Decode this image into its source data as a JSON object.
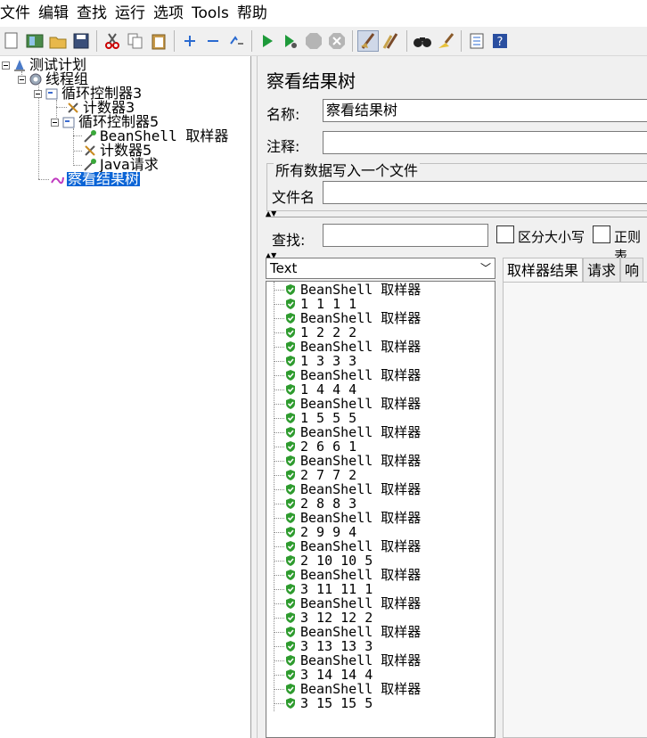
{
  "menu": [
    "文件",
    "编辑",
    "查找",
    "运行",
    "选项",
    "Tools",
    "帮助"
  ],
  "toolbar": {
    "icons": [
      "new-icon",
      "templates-icon",
      "open-icon",
      "save-icon",
      "cut-icon",
      "copy-icon",
      "paste-icon",
      "expand-icon",
      "collapse-icon",
      "toggle-icon",
      "start-icon",
      "start-no-pause-icon",
      "stop-icon",
      "shutdown-icon",
      "clear-icon",
      "clear-all-icon",
      "search-icon",
      "reset-search-icon",
      "function-helper-icon",
      "help-icon"
    ]
  },
  "tree": {
    "test_plan": "测试计划",
    "thread_group": "线程组",
    "loop3": "循环控制器3",
    "counter3": "计数器3",
    "loop5": "循环控制器5",
    "beanshell": "BeanShell 取样器",
    "counter5": "计数器5",
    "java_request": "Java请求",
    "view_results_tree": "察看结果树"
  },
  "panel": {
    "title": "察看结果树",
    "name_label": "名称:",
    "name_value": "察看结果树",
    "comment_label": "注释:",
    "comment_value": "",
    "file_group_title": "所有数据写入一个文件",
    "filename_label": "文件名",
    "filename_value": "",
    "search_label": "查找:",
    "search_value": "",
    "case_sensitive": "区分大小写",
    "regex": "正则表"
  },
  "results": {
    "renderer": "Text",
    "rows": [
      "BeanShell 取样器",
      "1 1 1 1",
      "BeanShell 取样器",
      "1 2 2 2",
      "BeanShell 取样器",
      "1 3 3 3",
      "BeanShell 取样器",
      "1 4 4 4",
      "BeanShell 取样器",
      "1 5 5 5",
      "BeanShell 取样器",
      "2 6 6 1",
      "BeanShell 取样器",
      "2 7 7 2",
      "BeanShell 取样器",
      "2 8 8 3",
      "BeanShell 取样器",
      "2 9 9 4",
      "BeanShell 取样器",
      "2 10 10 5",
      "BeanShell 取样器",
      "3 11 11 1",
      "BeanShell 取样器",
      "3 12 12 2",
      "BeanShell 取样器",
      "3 13 13 3",
      "BeanShell 取样器",
      "3 14 14 4",
      "BeanShell 取样器",
      "3 15 15 5"
    ],
    "tabs": [
      "取样器结果",
      "请求",
      "响"
    ]
  },
  "colors": {
    "selection": "#0a64d6",
    "success_green": "#2e9b2e"
  }
}
